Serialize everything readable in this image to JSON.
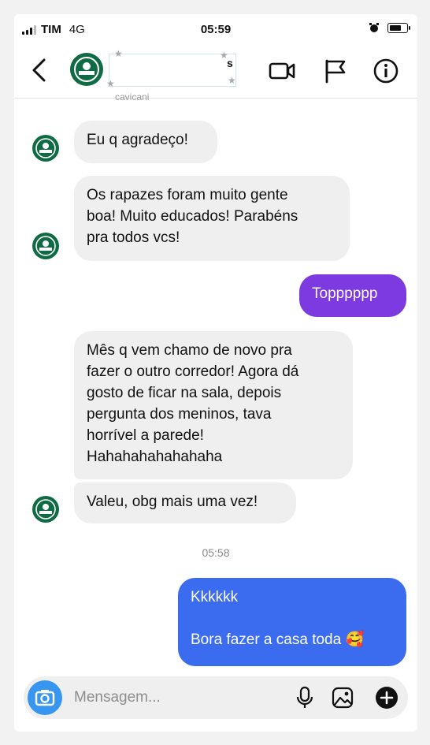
{
  "status_bar": {
    "carrier": "TIM",
    "network": "4G",
    "time": "05:59"
  },
  "header": {
    "contact_name": "cavicani",
    "name_fragment": "s"
  },
  "messages": [
    {
      "side": "in",
      "text": "Eu q agradeço!"
    },
    {
      "side": "in",
      "lines": [
        "Os rapazes foram muito gente",
        "boa! Muito educados! Parabéns",
        "pra todos vcs!"
      ]
    },
    {
      "side": "out",
      "text": "Topppppp"
    },
    {
      "side": "in",
      "lines": [
        "Mês q vem chamo de novo pra",
        "fazer o outro corredor! Agora dá",
        "gosto de ficar na sala, depois",
        "pergunta dos meninos, tava",
        "horrível a parede!",
        "Hahahahahahahaha"
      ]
    },
    {
      "side": "in",
      "text": "Valeu, obg mais uma vez!"
    },
    {
      "side": "out",
      "lines": [
        "Kkkkkk",
        "",
        "Bora fazer a casa toda 🥰"
      ]
    }
  ],
  "timestamp": "05:58",
  "composer": {
    "placeholder": "Mensagem..."
  },
  "colors": {
    "incoming_bubble": "#efefef",
    "outgoing_purple": "#7c3ae0",
    "outgoing_blue": "#3b6cf0",
    "camera_button": "#3797f0",
    "avatar_green": "#0e6b43"
  },
  "icons": [
    "back-icon",
    "video-call-icon",
    "flag-icon",
    "info-icon",
    "camera-icon",
    "microphone-icon",
    "gallery-icon",
    "plus-icon"
  ]
}
